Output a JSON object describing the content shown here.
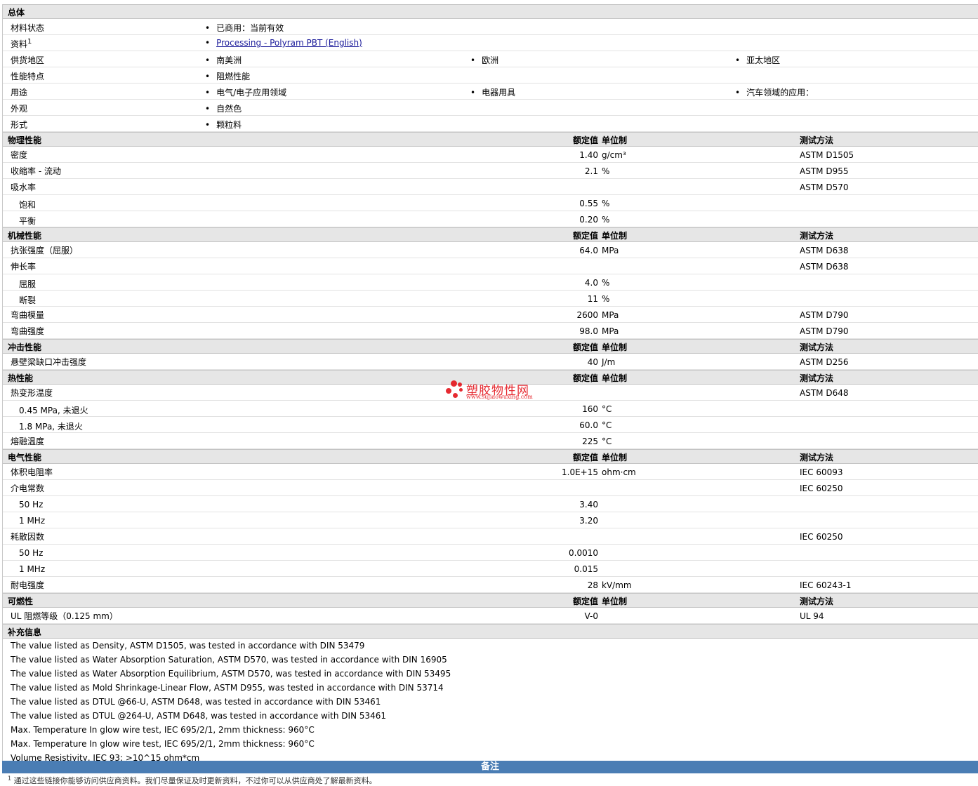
{
  "general": {
    "title": "总体",
    "rows": [
      {
        "label": "材料状态",
        "sup": "",
        "items": [
          "已商用：当前有效"
        ],
        "link": false
      },
      {
        "label": "资料",
        "sup": "1",
        "items": [
          "Processing - Polyram PBT (English)"
        ],
        "link": true
      },
      {
        "label": "供货地区",
        "sup": "",
        "items": [
          "南美洲",
          "欧洲",
          "亚太地区"
        ],
        "link": false
      },
      {
        "label": "性能特点",
        "sup": "",
        "items": [
          "阻燃性能"
        ],
        "link": false
      },
      {
        "label": "用途",
        "sup": "",
        "items": [
          "电气/电子应用领域",
          "电器用具",
          "汽车领域的应用："
        ],
        "link": false
      },
      {
        "label": "外观",
        "sup": "",
        "items": [
          "自然色"
        ],
        "link": false
      },
      {
        "label": "形式",
        "sup": "",
        "items": [
          "颗粒料"
        ],
        "link": false
      }
    ]
  },
  "headers": {
    "value": "额定值",
    "unit": "单位制",
    "test": "测试方法"
  },
  "sections": [
    {
      "title": "物理性能",
      "rows": [
        {
          "label": "密度",
          "sub": false,
          "value": "1.40",
          "unit": "g/cm³",
          "test": "ASTM D1505"
        },
        {
          "label": "收缩率  - 流动",
          "sub": false,
          "value": "2.1",
          "unit": "%",
          "test": "ASTM D955"
        },
        {
          "label": "吸水率",
          "sub": false,
          "value": "",
          "unit": "",
          "test": "ASTM D570"
        },
        {
          "label": "饱和",
          "sub": true,
          "value": "0.55",
          "unit": "%",
          "test": ""
        },
        {
          "label": "平衡",
          "sub": true,
          "value": "0.20",
          "unit": "%",
          "test": ""
        }
      ]
    },
    {
      "title": "机械性能",
      "rows": [
        {
          "label": "抗张强度（屈服）",
          "sub": false,
          "value": "64.0",
          "unit": "MPa",
          "test": "ASTM D638"
        },
        {
          "label": "伸长率",
          "sub": false,
          "value": "",
          "unit": "",
          "test": "ASTM D638"
        },
        {
          "label": "屈服",
          "sub": true,
          "value": "4.0",
          "unit": "%",
          "test": ""
        },
        {
          "label": "断裂",
          "sub": true,
          "value": "11",
          "unit": "%",
          "test": ""
        },
        {
          "label": "弯曲模量",
          "sub": false,
          "value": "2600",
          "unit": "MPa",
          "test": "ASTM D790"
        },
        {
          "label": "弯曲强度",
          "sub": false,
          "value": "98.0",
          "unit": "MPa",
          "test": "ASTM D790"
        }
      ]
    },
    {
      "title": "冲击性能",
      "rows": [
        {
          "label": "悬壁梁缺口冲击强度",
          "sub": false,
          "value": "40",
          "unit": "J/m",
          "test": "ASTM D256"
        }
      ]
    },
    {
      "title": "热性能",
      "rows": [
        {
          "label": "热变形温度",
          "sub": false,
          "value": "",
          "unit": "",
          "test": "ASTM D648"
        },
        {
          "label": "0.45 MPa, 未退火",
          "sub": true,
          "value": "160",
          "unit": "°C",
          "test": ""
        },
        {
          "label": "1.8 MPa, 未退火",
          "sub": true,
          "value": "60.0",
          "unit": "°C",
          "test": ""
        },
        {
          "label": "熔融温度",
          "sub": false,
          "value": "225",
          "unit": "°C",
          "test": ""
        }
      ]
    },
    {
      "title": "电气性能",
      "rows": [
        {
          "label": "体积电阻率",
          "sub": false,
          "value": "1.0E+15",
          "unit": "ohm·cm",
          "test": "IEC 60093"
        },
        {
          "label": "介电常数",
          "sub": false,
          "value": "",
          "unit": "",
          "test": "IEC 60250"
        },
        {
          "label": "50 Hz",
          "sub": true,
          "value": "3.40",
          "unit": "",
          "test": ""
        },
        {
          "label": "1 MHz",
          "sub": true,
          "value": "3.20",
          "unit": "",
          "test": ""
        },
        {
          "label": "耗散因数",
          "sub": false,
          "value": "",
          "unit": "",
          "test": "IEC 60250"
        },
        {
          "label": "50 Hz",
          "sub": true,
          "value": "0.0010",
          "unit": "",
          "test": ""
        },
        {
          "label": "1 MHz",
          "sub": true,
          "value": "0.015",
          "unit": "",
          "test": ""
        },
        {
          "label": "耐电强度",
          "sub": false,
          "value": "28",
          "unit": "kV/mm",
          "test": "IEC 60243-1"
        }
      ]
    },
    {
      "title": "可燃性",
      "rows": [
        {
          "label": "UL 阻燃等级（0.125 mm）",
          "sub": false,
          "value": "V-0",
          "unit": "",
          "test": "UL 94"
        }
      ]
    }
  ],
  "notes": {
    "title": "补充信息",
    "lines": [
      "The value listed as Density, ASTM D1505, was tested in accordance with DIN 53479",
      "The value listed as Water Absorption Saturation, ASTM D570, was tested in accordance with DIN 16905",
      "The value listed as Water Absorption Equilibrium, ASTM D570, was tested in accordance with DIN 53495",
      "The value listed as Mold Shrinkage-Linear Flow, ASTM D955, was tested in accordance with DIN 53714",
      "The value listed as DTUL @66-U, ASTM D648, was tested in accordance with DIN 53461",
      "The value listed as DTUL @264-U, ASTM D648, was tested in accordance with DIN 53461",
      "Max. Temperature In glow wire test, IEC 695/2/1, 2mm thickness: 960°C",
      "Max. Temperature In glow wire test, IEC 695/2/1, 2mm thickness: 960°C",
      "Volume Resistivity, IEC 93: >10^15 ohm*cm"
    ]
  },
  "remarks": {
    "title": "备注",
    "footnote_num": "1",
    "footnote": "通过这些链接你能够访问供应商资料。我们尽量保证及时更新资料，不过你可以从供应商处了解最新资料。"
  },
  "watermark": {
    "name": "塑胶物性网",
    "url": "www.sujiaowuxing.com",
    "color": "#e4141b"
  }
}
